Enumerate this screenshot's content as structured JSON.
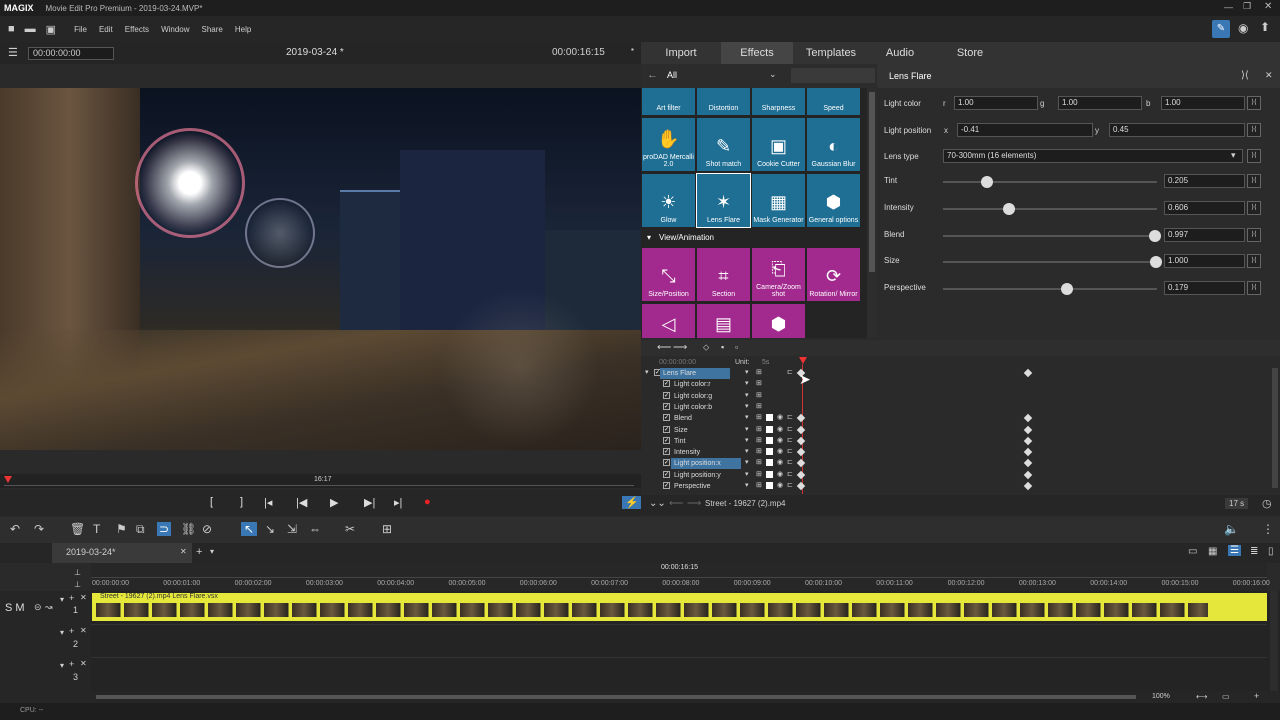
{
  "titlebar": {
    "logo": "MAGIX",
    "title": "Movie Edit Pro Premium - 2019-03-24.MVP*"
  },
  "menu": [
    "File",
    "Edit",
    "Effects",
    "Window",
    "Share",
    "Help"
  ],
  "preview": {
    "timecode_start": "00:00:00:00",
    "project": "2019-03-24 *",
    "timecode_end": "00:00:16:15",
    "position_label": "16:17"
  },
  "tabs": [
    "Import",
    "Effects",
    "Templates",
    "Audio",
    "Store"
  ],
  "effects": {
    "category": "All",
    "row_labels_top": [
      "Art filter",
      "Distortion",
      "Sharpness",
      "Speed"
    ],
    "tiles_row1": [
      "proDAD Mercalli 2.0",
      "Shot match",
      "Cookie Cutter",
      "Gaussian Blur"
    ],
    "tiles_row2": [
      "Glow",
      "Lens Flare",
      "Mask Generator",
      "General options"
    ],
    "section": "View/Animation",
    "tiles_row3": [
      "Size/Position",
      "Section",
      "Camera/Zoom shot",
      "Rotation/ Mirror"
    ]
  },
  "props": {
    "title": "Lens Flare",
    "light_color": {
      "label": "Light color",
      "r_label": "r",
      "r": "1.00",
      "g_label": "g",
      "g": "1.00",
      "b_label": "b",
      "b": "1.00"
    },
    "light_position": {
      "label": "Light position",
      "x_label": "x",
      "x": "-0.41",
      "y_label": "y",
      "y": "0.45"
    },
    "lens_type": {
      "label": "Lens type",
      "value": "70-300mm (16 elements)"
    },
    "sliders": [
      {
        "label": "Tint",
        "value": "0.205",
        "pos": 0.205
      },
      {
        "label": "Intensity",
        "value": "0.606",
        "pos": 0.307
      },
      {
        "label": "Blend",
        "value": "0.997",
        "pos": 0.99
      },
      {
        "label": "Size",
        "value": "1.000",
        "pos": 0.995
      },
      {
        "label": "Perspective",
        "value": "0.179",
        "pos": 0.58
      }
    ]
  },
  "keyframes": {
    "timecode": "00:00:00:00",
    "unit_label": "Unit:",
    "unit_value": "5s",
    "rows": [
      "Lens Flare",
      "Light color:r",
      "Light color:g",
      "Light color:b",
      "Blend",
      "Size",
      "Tint",
      "Intensity",
      "Light position:x",
      "Light position:y",
      "Perspective"
    ],
    "footer_file": "Street - 19627 (2).mp4",
    "footer_time": "17 s"
  },
  "timeline": {
    "project_tab": "2019-03-24*",
    "cursor_time": "00:00:16:15",
    "ruler": [
      "00:00:00:00",
      "00:00:01:00",
      "00:00:02:00",
      "00:00:03:00",
      "00:00:04:00",
      "00:00:05:00",
      "00:00:06:00",
      "00:00:07:00",
      "00:00:08:00",
      "00:00:09:00",
      "00:00:10:00",
      "00:00:11:00",
      "00:00:12:00",
      "00:00:13:00",
      "00:00:14:00",
      "00:00:15:00",
      "00:00:16:00"
    ],
    "track_labels": [
      "1",
      "2",
      "3"
    ],
    "clip_label": "Street - 19627 (2).mp4  Lens Flare.vsx",
    "track_controls": "S M",
    "zoom": "100%"
  },
  "status": {
    "cpu": "CPU: --"
  }
}
